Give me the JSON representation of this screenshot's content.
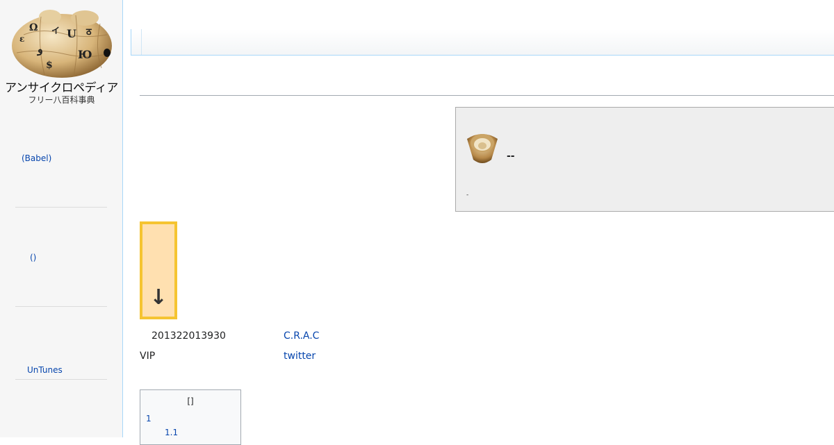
{
  "logo": {
    "name": "アンサイクロペディア",
    "subtitle": "フリー八百科事典"
  },
  "sidebar": {
    "items": [
      {
        "label": "(Babel)"
      },
      {
        "label": "()"
      },
      {
        "label": "UnTunes"
      }
    ]
  },
  "notice": {
    "title": "--",
    "small_text": "-"
  },
  "arrow_box": {
    "glyph": "↓"
  },
  "info": {
    "date": "201322013930",
    "crac_link": "C.R.A.C",
    "vip": "VIP",
    "twitter_link": "twitter"
  },
  "toc": {
    "title": "[]",
    "items": [
      {
        "number": "1"
      },
      {
        "number": "1.1"
      }
    ]
  },
  "colors": {
    "link": "#0645ad",
    "sidebar_border": "#a7d7f9",
    "notice_bg": "#eeeeee",
    "arrow_box_fill": "#ffe0b0",
    "arrow_box_border": "#f5c431"
  }
}
